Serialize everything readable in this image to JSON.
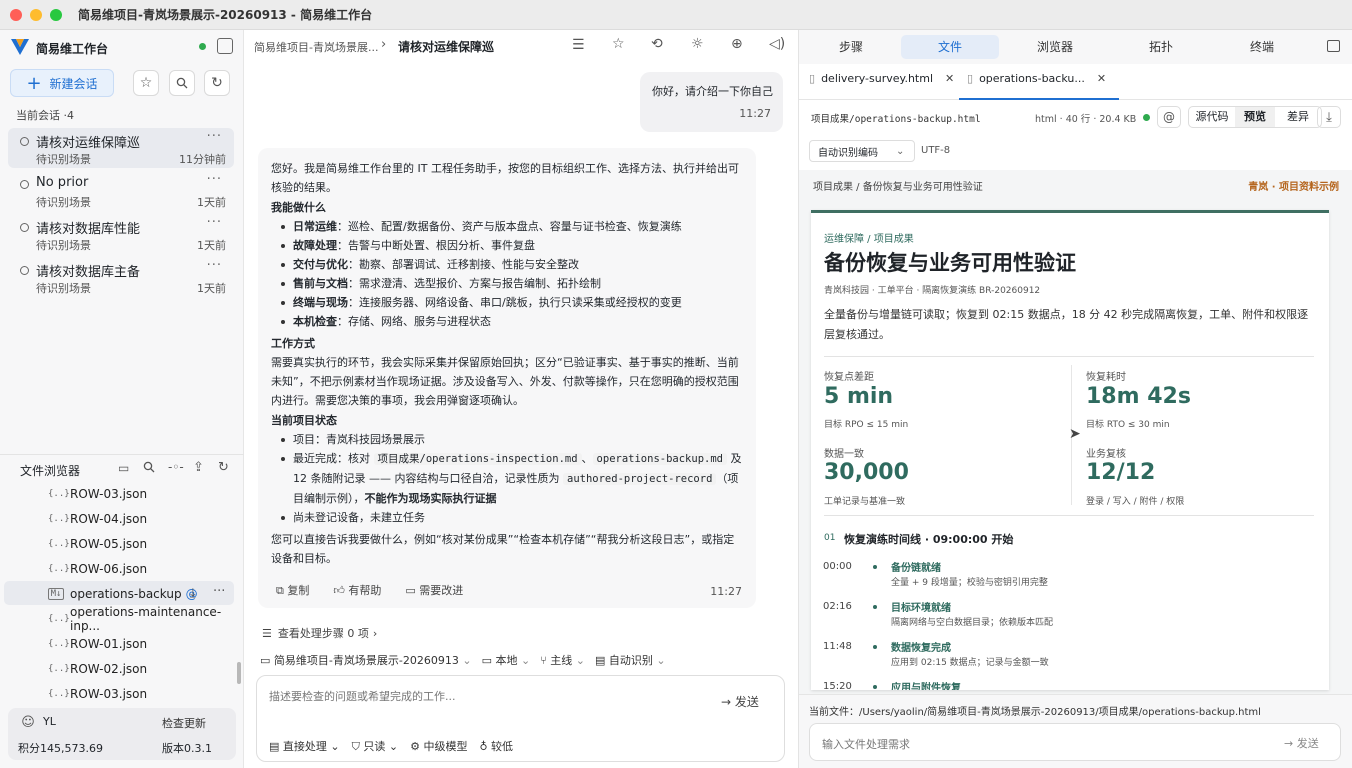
{
  "window": {
    "title": "简易维项目-青岚场景展示-20260913 - 简易维工作台"
  },
  "sidebar": {
    "app_name": "简易维工作台",
    "new_chat": "新建会话",
    "sessions_header": "当前会话 ·4",
    "sessions": [
      {
        "title": "请核对运维保障巡",
        "sub": "待识别场景",
        "time": "11分钟前"
      },
      {
        "title": "No prior",
        "sub": "待识别场景",
        "time": "1天前"
      },
      {
        "title": "请核对数据库性能",
        "sub": "待识别场景",
        "time": "1天前"
      },
      {
        "title": "请核对数据库主备",
        "sub": "待识别场景",
        "time": "1天前"
      }
    ],
    "browser_title": "文件浏览器",
    "files": [
      "ROW-03.json",
      "ROW-04.json",
      "ROW-05.json",
      "ROW-06.json",
      "operations-backup",
      "operations-maintenance-inp...",
      "ROW-01.json",
      "ROW-02.json",
      "ROW-03.json"
    ],
    "file_icons": [
      "{..}",
      "{..}",
      "{..}",
      "{..}",
      "M↓",
      "{..}",
      "{..}",
      "{..}",
      "{..}"
    ],
    "user": {
      "name": "YL",
      "update": "检查更新",
      "points": "积分145,573.69",
      "version": "版本0.3.1"
    }
  },
  "chat": {
    "breadcrumb": "简易维项目-青岚场景展...",
    "title": "请核对运维保障巡",
    "user_msg": "你好，请介绍一下你自己",
    "user_time": "11:27",
    "intro": "您好。我是简易维工作台里的 IT 工程任务助手，按您的目标组织工作、选择方法、执行并给出可核验的结果。",
    "can_title": "我能做什么",
    "can": [
      {
        "k": "日常运维",
        "v": "：巡检、配置/数据备份、资产与版本盘点、容量与证书检查、恢复演练"
      },
      {
        "k": "故障处理",
        "v": "：告警与中断处置、根因分析、事件复盘"
      },
      {
        "k": "交付与优化",
        "v": "：勘察、部署调试、迁移割接、性能与安全整改"
      },
      {
        "k": "售前与文档",
        "v": "：需求澄清、选型报价、方案与报告编制、拓扑绘制"
      },
      {
        "k": "终端与现场",
        "v": "：连接服务器、网络设备、串口/跳板，执行只读采集或经授权的变更"
      },
      {
        "k": "本机检查",
        "v": "：存储、网络、服务与进程状态"
      }
    ],
    "way_title": "工作方式",
    "way": "需要真实执行的环节，我会实际采集并保留原始回执；区分“已验证事实、基于事实的推断、当前未知”，不把示例素材当作现场证据。涉及设备写入、外发、付款等操作，只在您明确的授权范围内进行。需要您决策的事项，我会用弹窗逐项确认。",
    "status_title": "当前项目状态",
    "s1": "项目：青岚科技园场景展示",
    "s2a": "最近完成：核对",
    "s2c1": "项目成果/operations-inspection.md",
    "s2c2": "operations-backup.md",
    "s2b": "及 12 条随附记录 —— 内容结构与口径自洽，记录性质为",
    "s2c3": "authored-project-record",
    "s2d": "（项目编制示例），",
    "s2e": "不能作为现场实际执行证据",
    "s3": "尚未登记设备，未建立任务",
    "closing": "您可以直接告诉我要做什么，例如“核对某份成果”“检查本机存储”“帮我分析这段日志”，或指定设备和目标。",
    "copy": "复制",
    "helpful": "有帮助",
    "improve": "需要改进",
    "reply_time": "11:27",
    "steps": "查看处理步骤 0 项",
    "ctx_project": "简易维项目-青岚场景展示-20260913",
    "ctx_local": "本地",
    "ctx_branch": "主线",
    "ctx_auto": "自动识别",
    "input_placeholder": "描述要检查的问题或希望完成的工作...",
    "send": "发送",
    "opt1": "直接处理",
    "opt2": "只读",
    "opt3": "中级模型",
    "opt4": "较低"
  },
  "panel": {
    "tabs": [
      "步骤",
      "文件",
      "浏览器",
      "拓扑",
      "终端"
    ],
    "file_tabs": [
      "delivery-survey.html",
      "operations-backu..."
    ],
    "path": "项目成果/operations-backup.html",
    "meta": "html · 40 行 · 20.4 KB",
    "view_source": "源代码",
    "view_preview": "预览",
    "view_diff": "差异",
    "encoding": "自动识别编码",
    "charset": "UTF-8",
    "crumb": "项目成果 / 备份恢复与业务可用性验证",
    "crumb_right": "青岚 · 项目资料示例",
    "doc": {
      "eyebrow": "运维保障 / 项目成果",
      "title": "备份恢复与业务可用性验证",
      "meta": "青岚科技园 · 工单平台 · 隔离恢复演练 BR-20260912",
      "summary": "全量备份与增量链可读取；恢复到 02:15 数据点，18 分 42 秒完成隔离恢复，工单、附件和权限逐层复核通过。",
      "kpis": [
        {
          "label": "恢复点差距",
          "value": "5 min",
          "note": "目标 RPO ≤ 15 min"
        },
        {
          "label": "恢复耗时",
          "value": "18m 42s",
          "note": "目标 RTO ≤ 30 min"
        },
        {
          "label": "数据一致",
          "value": "30,000",
          "note": "工单记录与基准一致"
        },
        {
          "label": "业务复核",
          "value": "12/12",
          "note": "登录 / 写入 / 附件 / 权限"
        }
      ],
      "section_no": "01",
      "section_title": "恢复演练时间线 · 09:00:00 开始",
      "timeline": [
        {
          "t": "00:00",
          "h": "备份链就绪",
          "d": "全量 + 9 段增量；校验与密钥引用完整"
        },
        {
          "t": "02:16",
          "h": "目标环境就绪",
          "d": "隔离网络与空白数据目录；依赖版本匹配"
        },
        {
          "t": "11:48",
          "h": "数据恢复完成",
          "d": "应用到 02:15 数据点；记录与金额一致"
        },
        {
          "t": "15:20",
          "h": "应用与附件恢复",
          "d": ""
        }
      ]
    },
    "current_file": "当前文件：/Users/yaolin/简易维项目-青岚场景展示-20260913/项目成果/operations-backup.html",
    "input_placeholder": "输入文件处理需求",
    "send": "发送"
  }
}
